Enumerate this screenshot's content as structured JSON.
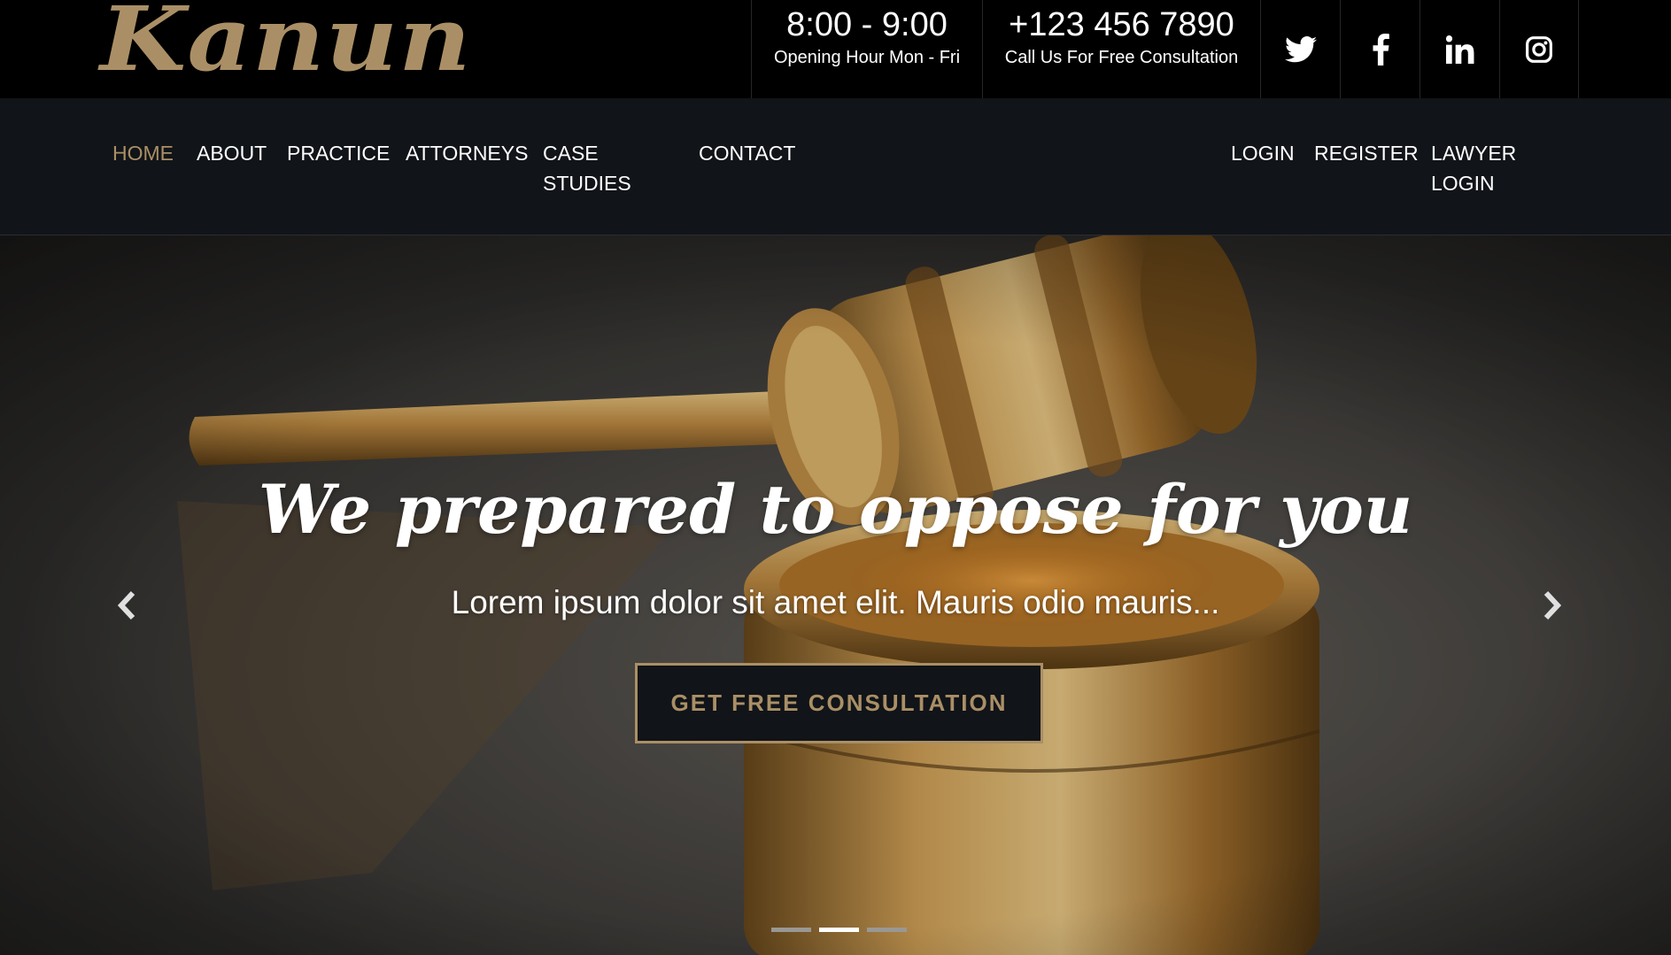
{
  "brand": {
    "logo_text": "Kanun",
    "accent_color": "#aa8f66"
  },
  "header": {
    "hours": {
      "value": "8:00 - 9:00",
      "caption": "Opening Hour Mon - Fri"
    },
    "phone": {
      "value": "+123 456 7890",
      "caption": "Call Us For Free Consultation"
    },
    "social": [
      {
        "icon": "twitter-icon"
      },
      {
        "icon": "facebook-icon"
      },
      {
        "icon": "linkedin-icon"
      },
      {
        "icon": "instagram-icon"
      }
    ]
  },
  "nav": {
    "items": [
      {
        "label": "HOME",
        "active": true
      },
      {
        "label": "ABOUT"
      },
      {
        "label": "PRACTICE"
      },
      {
        "label": "ATTORNEYS"
      },
      {
        "label": "CASE STUDIES"
      },
      {
        "label": "CONTACT"
      }
    ],
    "account": [
      {
        "label": "LOGIN"
      },
      {
        "label": "REGISTER"
      },
      {
        "label": "LAWYER LOGIN"
      }
    ]
  },
  "hero": {
    "title": "We prepared to oppose for you",
    "subtitle": "Lorem ipsum dolor sit amet elit. Mauris odio mauris...",
    "cta_label": "GET FREE CONSULTATION",
    "slide_count": 3,
    "active_slide": 2,
    "prev_icon": "chevron-left-icon",
    "next_icon": "chevron-right-icon"
  }
}
